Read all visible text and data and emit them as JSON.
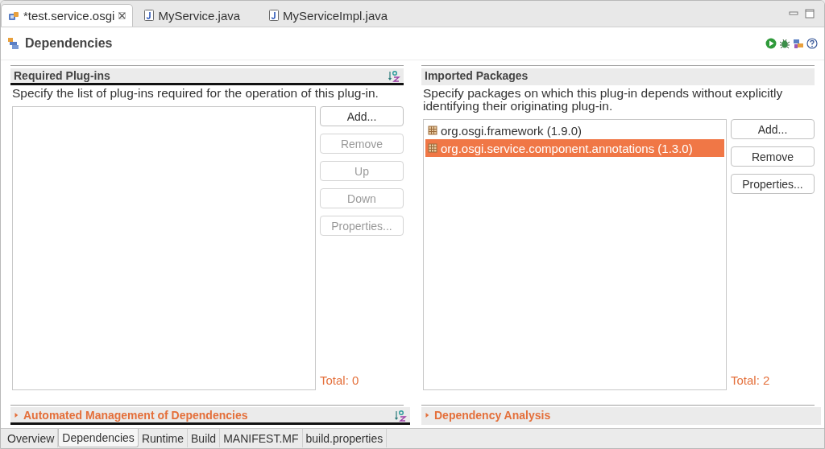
{
  "editor_tabs": [
    {
      "label": "*test.service.osgi",
      "kind": "plugin",
      "selected": true,
      "closable": true
    },
    {
      "label": "MyService.java",
      "kind": "java",
      "selected": false
    },
    {
      "label": "MyServiceImpl.java",
      "kind": "java",
      "selected": false
    }
  ],
  "page_title": "Dependencies",
  "columns": [
    {
      "main": {
        "title": "Required Plug-ins",
        "focused": true,
        "sort_button": true,
        "description": "Specify the list of plug-ins required for the operation of this plug-in.",
        "buttons": [
          {
            "label": "Add...",
            "disabled": false
          },
          {
            "label": "Remove",
            "disabled": true
          },
          {
            "label": "Up",
            "disabled": true
          },
          {
            "label": "Down",
            "disabled": true
          },
          {
            "label": "Properties...",
            "disabled": true
          }
        ],
        "total": "Total: 0"
      },
      "collapsed": {
        "title": "Automated Management of Dependencies",
        "expanded": false,
        "focused": true,
        "sort_button": true
      }
    },
    {
      "main": {
        "title": "Imported Packages",
        "focused": false,
        "description": "Specify packages on which this plug-in depends without explicitly identifying their originating plug-in.",
        "items": [
          {
            "label": "org.osgi.framework (1.9.0)",
            "selected": false
          },
          {
            "label": "org.osgi.service.component.annotations (1.3.0)",
            "selected": true
          }
        ],
        "buttons": [
          {
            "label": "Add...",
            "disabled": false
          },
          {
            "label": "Remove",
            "disabled": false
          },
          {
            "label": "Properties...",
            "disabled": false
          }
        ],
        "total": "Total: 2"
      },
      "collapsed": {
        "title": "Dependency Analysis",
        "expanded": false,
        "focused": false
      }
    }
  ],
  "bottom_tabs": [
    {
      "label": "Overview",
      "selected": false
    },
    {
      "label": "Dependencies",
      "selected": true
    },
    {
      "label": "Runtime",
      "selected": false
    },
    {
      "label": "Build",
      "selected": false
    },
    {
      "label": "MANIFEST.MF",
      "selected": false
    },
    {
      "label": "build.properties",
      "selected": false
    }
  ]
}
